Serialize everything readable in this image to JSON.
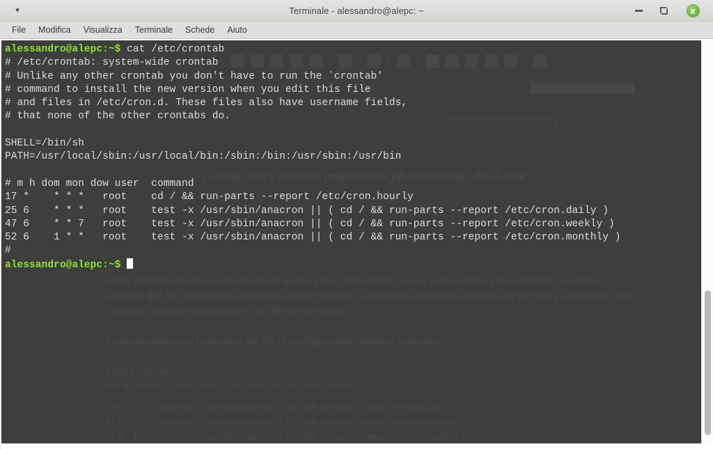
{
  "window": {
    "title": "Terminale - alessandro@alepc: ~",
    "caret_icon": "chevron-down-icon",
    "minimize_label": "–",
    "maximize_label": "",
    "close_label": "x"
  },
  "menubar": {
    "items": [
      {
        "label": "File"
      },
      {
        "label": "Modifica"
      },
      {
        "label": "Visualizza"
      },
      {
        "label": "Terminale"
      },
      {
        "label": "Schede"
      },
      {
        "label": "Aiuto"
      }
    ]
  },
  "terminal": {
    "prompt": "alessandro@alepc:~$",
    "command": " cat /etc/crontab",
    "prompt_color": "#8ae234",
    "text_color": "#dcdcdc",
    "background_color": "#3e3e3c",
    "output": [
      "# /etc/crontab: system-wide crontab",
      "# Unlike any other crontab you don't have to run the `crontab'",
      "# command to install the new version when you edit this file",
      "# and files in /etc/cron.d. These files also have username fields,",
      "# that none of the other crontabs do.",
      "",
      "SHELL=/bin/sh",
      "PATH=/usr/local/sbin:/usr/local/bin:/sbin:/bin:/usr/sbin:/usr/bin",
      "",
      "# m h dom mon dow user\tcommand",
      "17 *\t* * *\troot    cd / && run-parts --report /etc/cron.hourly",
      "25 6\t* * *\troot    test -x /usr/sbin/anacron || ( cd / && run-parts --report /etc/cron.daily )",
      "47 6\t* * 7\troot    test -x /usr/sbin/anacron || ( cd / && run-parts --report /etc/cron.weekly )",
      "52 6\t1 * *\troot    test -x /usr/sbin/anacron || ( cd / && run-parts --report /etc/cron.monthly )",
      "#"
    ],
    "output_text": "# /etc/crontab: system-wide crontab\n# Unlike any other crontab you don't have to run the `crontab'\n# command to install the new version when you edit this file\n# and files in /etc/cron.d. These files also have username fields,\n# that none of the other crontabs do.\n\nSHELL=/bin/sh\nPATH=/usr/local/sbin:/usr/local/bin:/sbin:/bin:/usr/sbin:/usr/bin\n\n# m h dom mon dow user  command\n17 *    * * *   root    cd / && run-parts --report /etc/cron.hourly\n25 6    * * *   root    test -x /usr/sbin/anacron || ( cd / && run-parts --report /etc/cron.daily )\n47 6    * * 7   root    test -x /usr/sbin/anacron || ( cd / && run-parts --report /etc/cron.weekly )\n52 6    1 * *   root    test -x /usr/sbin/anacron || ( cd / && run-parts --report /etc/cron.monthly )\n#",
    "cursor": "block-cursor"
  },
  "background_page": {
    "heading": "[Guida] Cron e Anacron: programmare job periodici su GNU/Linux",
    "paragraph_1": "Viene utilizzato in tutte quelle situazioni in cui la macchina rimane accesa senza soluzioni di continuità. Il servizio controlla due file: /etc/crontab dove sono conservate tutte le operazioni periodiche eseguite dal servizio e /etc/cron.d/ dove i pacchetti installati inseriscono i loro file se necessario.",
    "paragraph_2": "Possiamo analizzare la struttura del file di configurazione, dando il comando:",
    "code_block_1": "SHELL=/bin/sh\nPATH=/usr/local/sbin:/usr/local/bin:/sbin:/bin:/usr/sbin:/usr/bin",
    "code_block_2": "25 6    * * *   root test -x /usr/sbin/anacron || ( cd / && run-parts --report /etc/cron.daily )\n47 6    * * 7   root test -x /usr/sbin/anacron || ( cd / && run-parts --report /etc/cron.weekly )\n52 6    1 * *   root test -x /usr/sbin/anacron || ( cd / && run-parts --report /etc/cron.monthly )"
  },
  "scrollbar": {
    "thumb_top_percent": 62,
    "thumb_height_percent": 36
  }
}
